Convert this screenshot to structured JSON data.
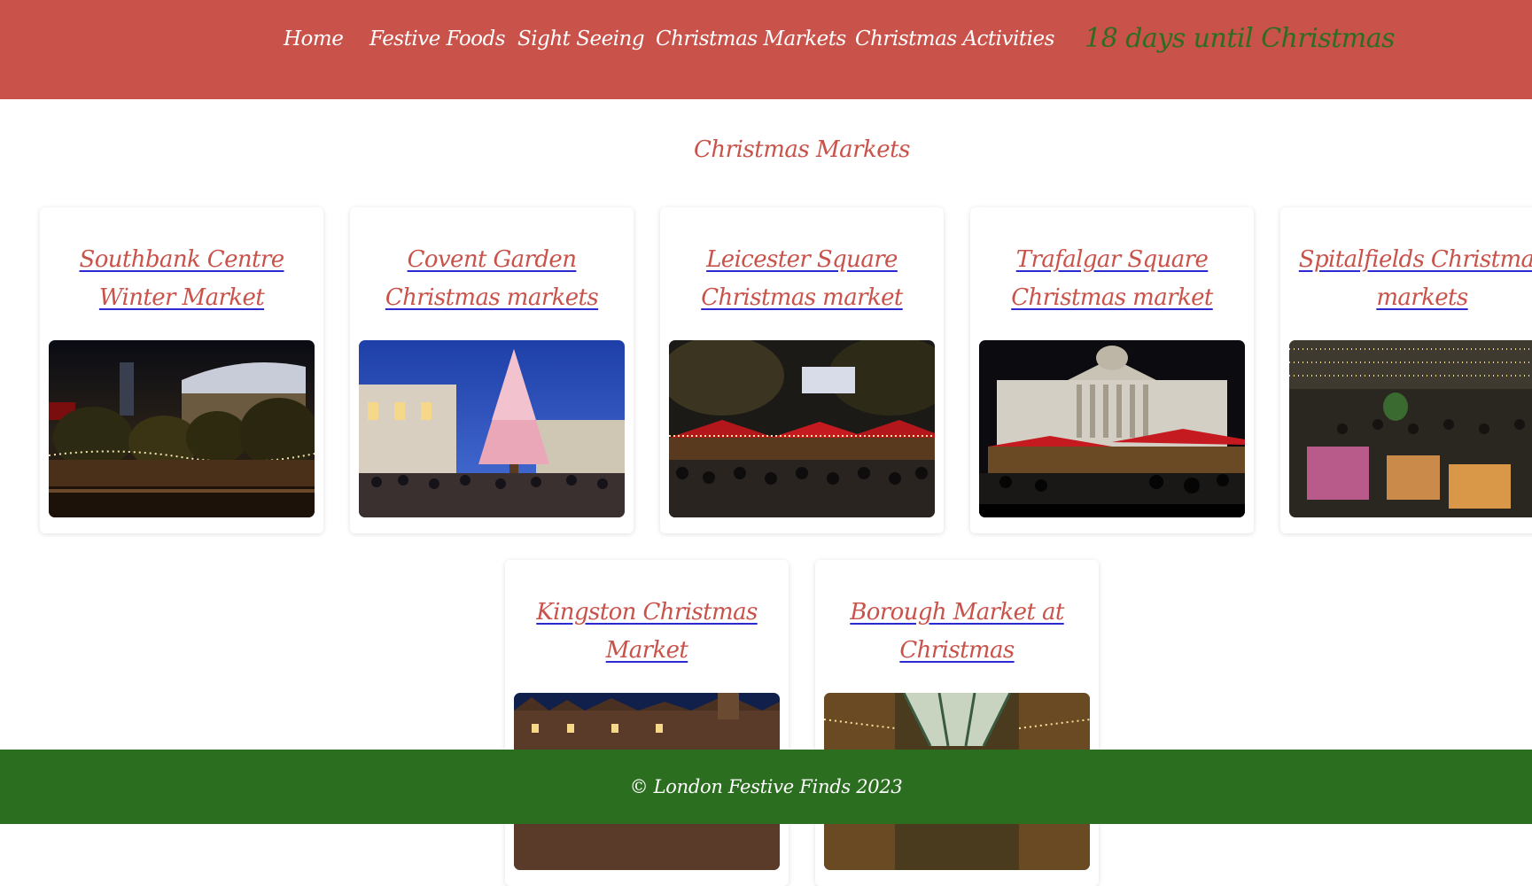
{
  "nav": {
    "items": [
      "Home",
      "Festive Foods",
      "Sight Seeing",
      "Christmas Markets",
      "Christmas Activities"
    ],
    "countdown": "18 days until Christmas"
  },
  "page_title": "Christmas Markets",
  "markets": [
    {
      "title": "Southbank Centre Winter Market",
      "image": "southbank-market-photo"
    },
    {
      "title": "Covent Garden Christmas markets",
      "image": "covent-garden-tree-photo"
    },
    {
      "title": "Leicester Square Christmas market",
      "image": "leicester-square-market-photo"
    },
    {
      "title": "Trafalgar Square Christmas market",
      "image": "trafalgar-square-market-photo"
    },
    {
      "title": "Spitalfields Christmas markets",
      "image": "spitalfields-market-photo"
    },
    {
      "title": "Kingston Christmas Market",
      "image": "kingston-market-photo"
    },
    {
      "title": "Borough Market at Christmas",
      "image": "borough-market-photo"
    }
  ],
  "footer": "© London Festive Finds 2023",
  "colors": {
    "header": "#c9524a",
    "accent_red": "#c9524a",
    "accent_green": "#2b6e1f",
    "link_underline": "#2a2ad0"
  }
}
